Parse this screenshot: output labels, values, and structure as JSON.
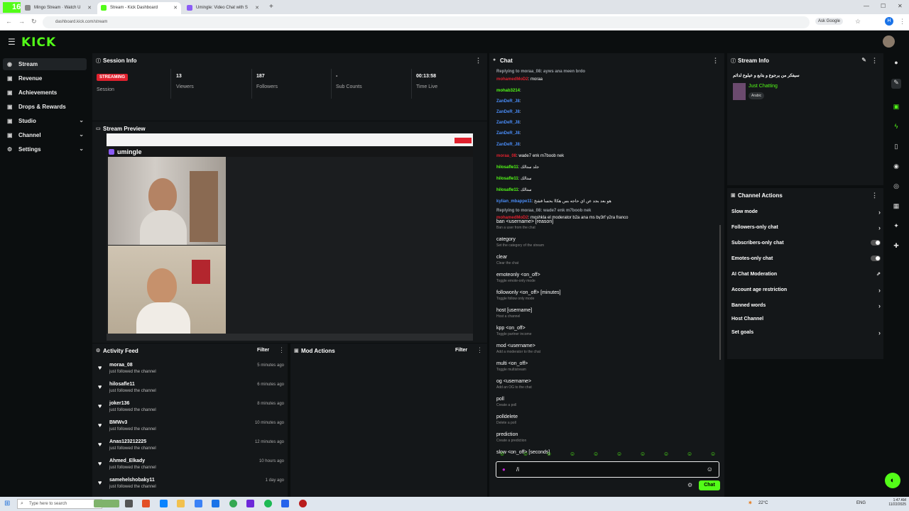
{
  "browser": {
    "tabs": [
      {
        "title": "Mingo Stream · Watch U"
      },
      {
        "title": "Stream - Kick Dashboard"
      },
      {
        "title": "Umingle: Video Chat with S"
      }
    ],
    "url": "dashboard.kick.com/stream",
    "ask_google": "Ask Google",
    "badge": "16"
  },
  "header": {
    "logo": "KICK"
  },
  "sidebar": {
    "items": [
      {
        "label": "Stream",
        "icon": "broadcast-icon"
      },
      {
        "label": "Revenue",
        "icon": "money-icon"
      },
      {
        "label": "Achievements",
        "icon": "trophy-icon"
      },
      {
        "label": "Drops & Rewards",
        "icon": "gift-icon"
      },
      {
        "label": "Studio",
        "icon": "studio-icon"
      },
      {
        "label": "Channel",
        "icon": "channel-icon"
      },
      {
        "label": "Settings",
        "icon": "gear-icon"
      }
    ]
  },
  "session": {
    "title": "Session Info",
    "badge": "STREAMING",
    "session_label": "Session",
    "stats": [
      {
        "value": "13",
        "label": "Viewers"
      },
      {
        "value": "187",
        "label": "Followers"
      },
      {
        "value": "-",
        "label": "Sub Counts"
      },
      {
        "value": "00:13:58",
        "label": "Time Live"
      }
    ]
  },
  "preview": {
    "title": "Stream Preview",
    "site_name": "umingle"
  },
  "activity": {
    "title": "Activity Feed",
    "filter": "Filter",
    "rows": [
      {
        "name": "moraa_08",
        "action": "just followed the channel",
        "time": "5 minutes ago"
      },
      {
        "name": "hilosafle11",
        "action": "just followed the channel",
        "time": "6 minutes ago"
      },
      {
        "name": "joker136",
        "action": "just followed the channel",
        "time": "8 minutes ago"
      },
      {
        "name": "BMWv3",
        "action": "just followed the channel",
        "time": "10 minutes ago"
      },
      {
        "name": "Anas123212225",
        "action": "just followed the channel",
        "time": "12 minutes ago"
      },
      {
        "name": "Ahmed_Elkady",
        "action": "just followed the channel",
        "time": "10 hours ago"
      },
      {
        "name": "samehelshobaky11",
        "action": "just followed the channel",
        "time": "1 day ago"
      }
    ]
  },
  "mod": {
    "title": "Mod Actions",
    "filter": "Filter"
  },
  "chat": {
    "title": "Chat",
    "lines": [
      {
        "user": "Replying to moraa_08: ayws ana meen brdo",
        "text": "",
        "color": "#9aa0a6"
      },
      {
        "user": "mohamedMoD2",
        "text": ": moraa",
        "color": "#e0212e"
      },
      {
        "user": "mohab3214",
        "text": ":",
        "color": "#53fc18"
      },
      {
        "user": "ZanDeR_J8",
        "text": ":",
        "color": "#4a8df8"
      },
      {
        "user": "ZanDeR_J8",
        "text": ":",
        "color": "#4a8df8"
      },
      {
        "user": "ZanDeR_J8",
        "text": ":",
        "color": "#4a8df8"
      },
      {
        "user": "ZanDeR_J8",
        "text": ":",
        "color": "#4a8df8"
      },
      {
        "user": "ZanDeR_J8",
        "text": ":",
        "color": "#4a8df8"
      },
      {
        "user": "moraa_08",
        "text": ": wade7 enk m7boob nek",
        "color": "#e0212e"
      },
      {
        "user": "hilosafle11",
        "text": ": جلد ستالك",
        "color": "#53fc18"
      },
      {
        "user": "hilosafle11",
        "text": ": ستالك",
        "color": "#53fc18"
      },
      {
        "user": "hilosafle11",
        "text": ": ستالك",
        "color": "#53fc18"
      },
      {
        "user": "kylian_mbappe11",
        "text": ": هو بعد بجد عن اي حاجه بس هكاا بحسا فشخ",
        "color": "#4a8df8"
      },
      {
        "user": "Replying to moraa_08: wade7 enk m7boob nek",
        "text": "",
        "color": "#9aa0a6"
      },
      {
        "user": "mohamedMoD2",
        "text": ": moshkla el moderator b2a ana ms by3rf y2ra franco",
        "color": "#e0212e"
      }
    ],
    "commands": [
      {
        "cmd": "ban <username> [reason]",
        "desc": "Ban a user from the chat"
      },
      {
        "cmd": "category",
        "desc": "Set the category of the stream"
      },
      {
        "cmd": "clear",
        "desc": "Clear the chat"
      },
      {
        "cmd": "emoteonly <on_off>",
        "desc": "Toggle emote-only mode"
      },
      {
        "cmd": "followonly <on_off> [minutes]",
        "desc": "Toggle follow only mode"
      },
      {
        "cmd": "host [username]",
        "desc": "Host a channel"
      },
      {
        "cmd": "kpp <on_off>",
        "desc": "Toggle partner income"
      },
      {
        "cmd": "mod <username>",
        "desc": "Add a moderator to the chat"
      },
      {
        "cmd": "multi <on_off>",
        "desc": "Toggle multistream"
      },
      {
        "cmd": "og <username>",
        "desc": "Add an OG to the chat"
      },
      {
        "cmd": "poll",
        "desc": "Create a poll"
      },
      {
        "cmd": "polldelete",
        "desc": "Delete a poll"
      },
      {
        "cmd": "prediction",
        "desc": "Create a prediction"
      },
      {
        "cmd": "slow <on_off> [seconds]",
        "desc": ""
      }
    ],
    "input_value": "/i",
    "send_label": "Chat"
  },
  "stream_info": {
    "title": "Stream Info",
    "stream_title": "سيفكر من يرجوع و بتابع و عيلوع لدائم",
    "category": "Just Chatting",
    "tag": "Arabic"
  },
  "channel_actions": {
    "title": "Channel Actions",
    "items": [
      {
        "label": "Slow mode",
        "control": "arrow"
      },
      {
        "label": "Followers-only chat",
        "control": "arrow"
      },
      {
        "label": "Subscribers-only chat",
        "control": "toggle"
      },
      {
        "label": "Emotes-only chat",
        "control": "toggle"
      },
      {
        "label": "AI Chat Moderation",
        "control": "external"
      },
      {
        "label": "Account age restriction",
        "control": "arrow"
      },
      {
        "label": "Banned words",
        "control": "arrow"
      },
      {
        "label": "Host Channel",
        "control": "none"
      },
      {
        "label": "Set goals",
        "control": "arrow"
      }
    ]
  },
  "taskbar": {
    "search_placeholder": "Type here to search",
    "weather": "22°C",
    "lang": "ENG",
    "time": "1:47 AM",
    "date": "11/22/2025"
  },
  "colors": {
    "accent": "#53fc18",
    "panel": "#141719",
    "live": "#e0212e"
  }
}
